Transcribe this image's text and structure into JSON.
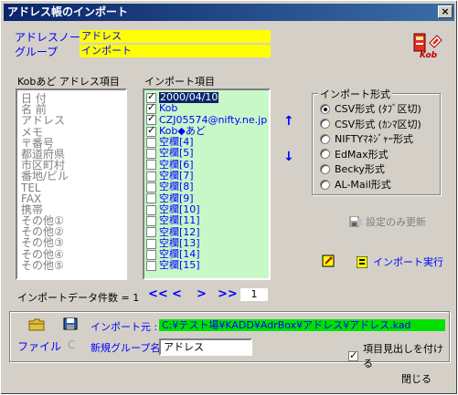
{
  "window": {
    "title": "アドレス帳のインポート",
    "close_glyph": "×"
  },
  "header": {
    "note_label": "アドレスノート",
    "note_value": "アドレス",
    "group_label": "グループ",
    "group_value": "インポート",
    "logo_text": "Kob"
  },
  "source_list": {
    "title": "Kobあど アドレス項目",
    "items": [
      "日 付",
      "名 前",
      "アドレス",
      "メモ",
      "〒番号",
      "都道府県",
      "市区町村",
      "番地/ビル",
      "TEL",
      "FAX",
      "携帯",
      "その他①",
      "その他②",
      "その他③",
      "その他④",
      "その他⑤"
    ]
  },
  "import_list": {
    "title": "インポート項目",
    "items": [
      {
        "label": "2000/04/10",
        "checked": true,
        "selected": true
      },
      {
        "label": "Kob",
        "checked": true,
        "selected": false
      },
      {
        "label": "CZJ05574@nifty.ne.jp",
        "checked": true,
        "selected": false
      },
      {
        "label": "Kob◆あど",
        "checked": true,
        "selected": false
      },
      {
        "label": "空欄[4]",
        "checked": false,
        "selected": false
      },
      {
        "label": "空欄[5]",
        "checked": false,
        "selected": false
      },
      {
        "label": "空欄[6]",
        "checked": false,
        "selected": false
      },
      {
        "label": "空欄[7]",
        "checked": false,
        "selected": false
      },
      {
        "label": "空欄[8]",
        "checked": false,
        "selected": false
      },
      {
        "label": "空欄[9]",
        "checked": false,
        "selected": false
      },
      {
        "label": "空欄[10]",
        "checked": false,
        "selected": false
      },
      {
        "label": "空欄[11]",
        "checked": false,
        "selected": false
      },
      {
        "label": "空欄[12]",
        "checked": false,
        "selected": false
      },
      {
        "label": "空欄[13]",
        "checked": false,
        "selected": false
      },
      {
        "label": "空欄[14]",
        "checked": false,
        "selected": false
      },
      {
        "label": "空欄[15]",
        "checked": false,
        "selected": false
      }
    ],
    "up_arrow": "↑",
    "down_arrow": "↓"
  },
  "format_group": {
    "title": "インポート形式",
    "options": [
      "CSV形式 (ﾀﾌﾞ区切)",
      "CSV形式 (ｶﾝﾏ区切)",
      "NIFTYﾏﾈｼﾞｬｰ形式",
      "EdMax形式",
      "Becky形式",
      "AL-Mail形式"
    ],
    "selected_index": 0
  },
  "actions": {
    "settings_update": "設定のみ更新",
    "import_run": "インポート実行"
  },
  "count": {
    "label": "インポートデータ件数 = 1"
  },
  "pager": {
    "first": "<<",
    "prev": "<",
    "next": ">",
    "last": ">>",
    "page": "1"
  },
  "file": {
    "file_label": "ファイル",
    "c_label": "C",
    "import_from_label": "インポート元 :",
    "import_from_value": "C:¥テスト場¥KADD¥AdrBox¥アドレス¥アドレス.kad",
    "new_group_label": "新規グループ名",
    "new_group_value": "アドレス",
    "header_checkbox_label": "項目見出しを付ける",
    "header_checkbox_checked": true
  },
  "close_button": "閉じる"
}
